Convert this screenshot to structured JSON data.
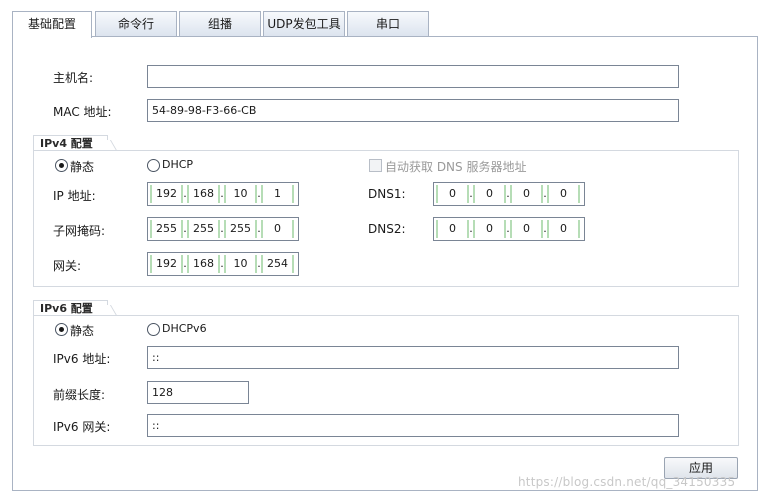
{
  "tabs": [
    {
      "label": "基础配置",
      "active": true
    },
    {
      "label": "命令行",
      "active": false
    },
    {
      "label": "组播",
      "active": false
    },
    {
      "label": "UDP发包工具",
      "active": false
    },
    {
      "label": "串口",
      "active": false
    }
  ],
  "basic": {
    "hostname_label": "主机名:",
    "hostname_value": "",
    "mac_label": "MAC 地址:",
    "mac_value": "54-89-98-F3-66-CB"
  },
  "ipv4": {
    "title": "IPv4 配置",
    "static_label": "静态",
    "dhcp_label": "DHCP",
    "mode": "static",
    "auto_dns_label": "自动获取 DNS 服务器地址",
    "auto_dns_checked": false,
    "ip_label": "IP 地址:",
    "ip": [
      "192",
      "168",
      "10",
      "1"
    ],
    "mask_label": "子网掩码:",
    "mask": [
      "255",
      "255",
      "255",
      "0"
    ],
    "gateway_label": "网关:",
    "gateway": [
      "192",
      "168",
      "10",
      "254"
    ],
    "dns1_label": "DNS1:",
    "dns1": [
      "0",
      "0",
      "0",
      "0"
    ],
    "dns2_label": "DNS2:",
    "dns2": [
      "0",
      "0",
      "0",
      "0"
    ]
  },
  "ipv6": {
    "title": "IPv6 配置",
    "static_label": "静态",
    "dhcp_label": "DHCPv6",
    "mode": "static",
    "addr_label": "IPv6 地址:",
    "addr_value": "::",
    "prefix_label": "前缀长度:",
    "prefix_value": "128",
    "gateway_label": "IPv6 网关:",
    "gateway_value": "::"
  },
  "apply_label": "应用",
  "watermark": "https://blog.csdn.net/qq_34150335",
  "colors": {
    "tab_border": "#a9b3c3",
    "octet_separator": "#b6ddb6"
  }
}
